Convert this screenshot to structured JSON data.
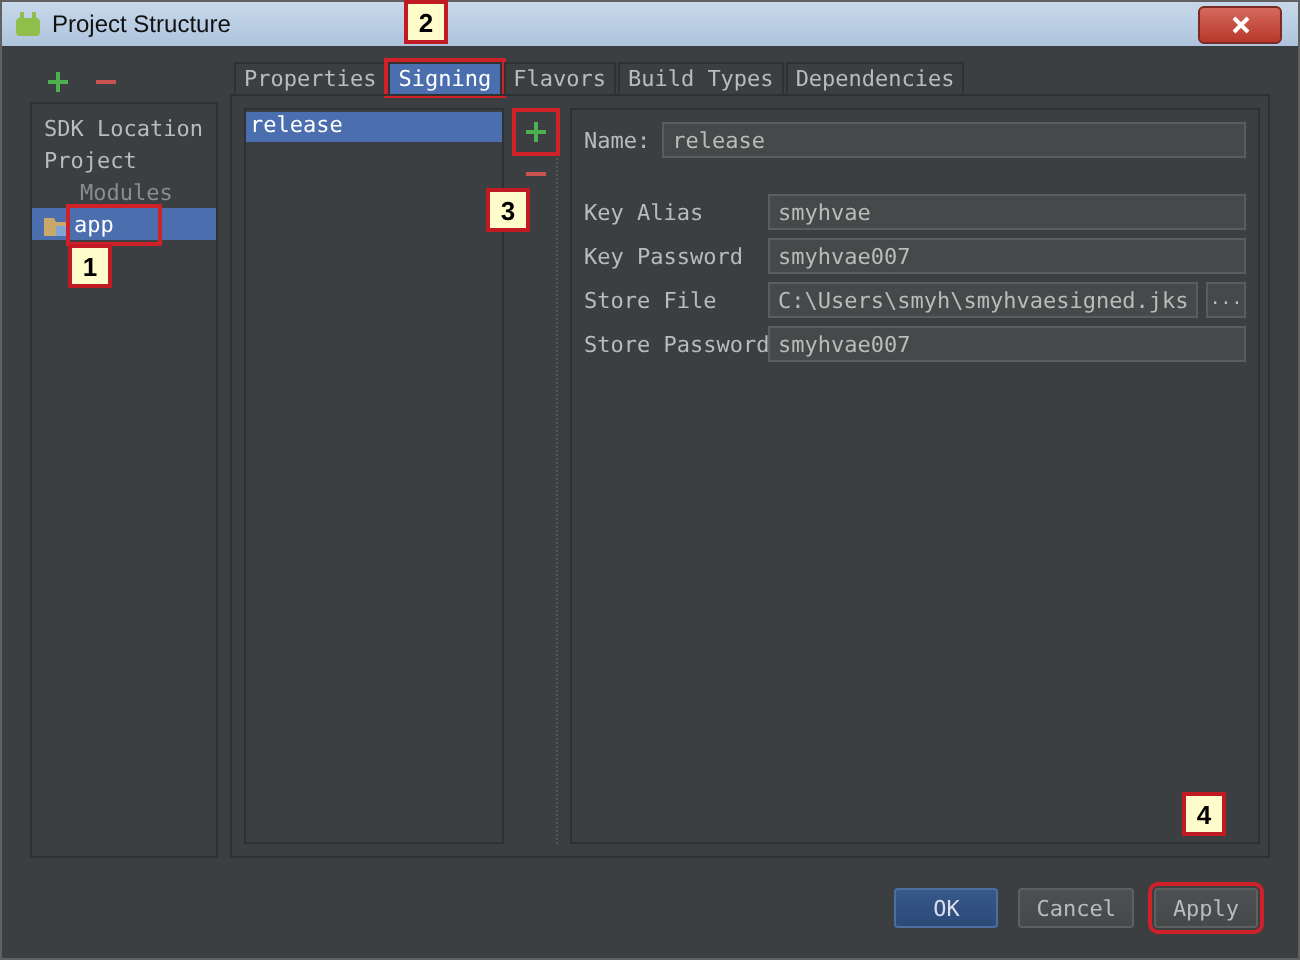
{
  "window": {
    "title": "Project Structure"
  },
  "sidebar": {
    "items": [
      {
        "label": "SDK Location",
        "kind": "item",
        "selected": false,
        "highlighted": false
      },
      {
        "label": "Project",
        "kind": "item",
        "selected": false,
        "highlighted": false
      },
      {
        "label": "Modules",
        "kind": "header",
        "selected": false,
        "highlighted": false
      },
      {
        "label": "app",
        "kind": "module",
        "selected": true,
        "highlighted": true
      }
    ]
  },
  "tabs": [
    {
      "label": "Properties",
      "selected": false,
      "highlighted": false
    },
    {
      "label": "Signing",
      "selected": true,
      "highlighted": true
    },
    {
      "label": "Flavors",
      "selected": false,
      "highlighted": false
    },
    {
      "label": "Build Types",
      "selected": false,
      "highlighted": false
    },
    {
      "label": "Dependencies",
      "selected": false,
      "highlighted": false
    }
  ],
  "signing_configs": [
    {
      "name": "release",
      "selected": true
    }
  ],
  "add_highlighted": true,
  "name_field": {
    "label": "Name:",
    "value": "release"
  },
  "fields": [
    {
      "label": "Key Alias",
      "value": "smyhvae",
      "kind": "text"
    },
    {
      "label": "Key Password",
      "value": "smyhvae007",
      "kind": "text"
    },
    {
      "label": "Store File",
      "value": "C:\\Users\\smyh\\smyhvaesigned.jks",
      "kind": "file",
      "browse": "..."
    },
    {
      "label": "Store Password",
      "value": "smyhvae007",
      "kind": "text"
    }
  ],
  "buttons": [
    {
      "label": "OK",
      "kind": "default",
      "highlighted": false
    },
    {
      "label": "Cancel",
      "kind": "normal",
      "highlighted": false
    },
    {
      "label": "Apply",
      "kind": "normal",
      "highlighted": true
    }
  ],
  "callouts": [
    "1",
    "2",
    "3",
    "4"
  ]
}
